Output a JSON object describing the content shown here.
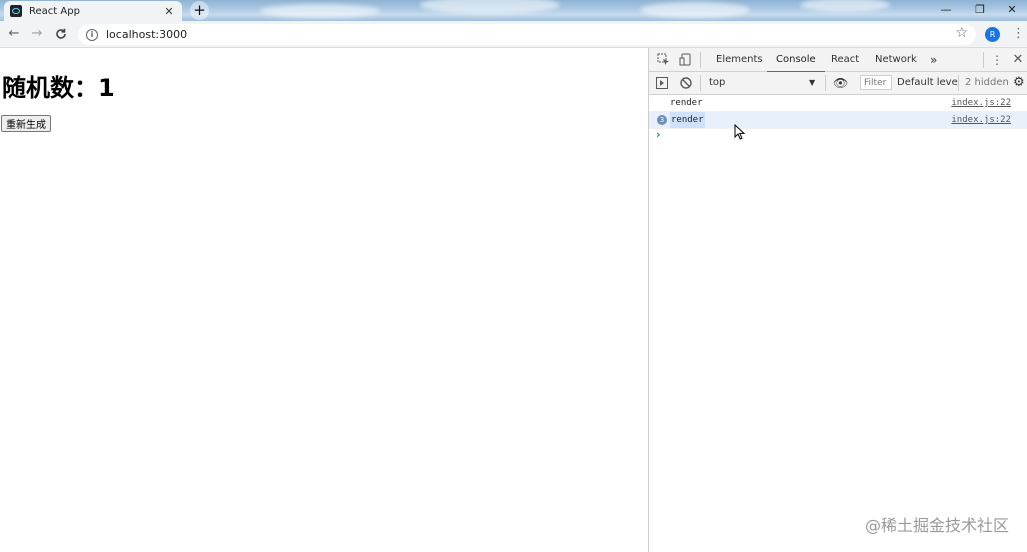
{
  "browser": {
    "tab_title": "React App",
    "tab_close": "✕",
    "new_tab": "+",
    "url": "localhost:3000",
    "window_controls": {
      "minimize": "—",
      "restore": "❐",
      "close": "✕"
    },
    "extension_label": "R"
  },
  "page": {
    "heading": "随机数：1",
    "regenerate_label": "重新生成"
  },
  "devtools": {
    "tabs": {
      "elements": "Elements",
      "console": "Console",
      "react": "React",
      "network": "Network",
      "more": "»"
    },
    "toolbar": {
      "context": "top",
      "filter_placeholder": "Filter",
      "levels": "Default leve",
      "hidden": "2 hidden"
    },
    "messages": [
      {
        "text": "render",
        "source": "index.js:22",
        "count": ""
      },
      {
        "text": "render",
        "source": "index.js:22",
        "count": "3"
      }
    ],
    "prompt": "›"
  },
  "watermark": "@稀土掘金技术社区",
  "colors": {
    "accent": "#1a73e8",
    "tab_bg": "#f1f3f4",
    "devtools_bg": "#f3f3f3"
  }
}
